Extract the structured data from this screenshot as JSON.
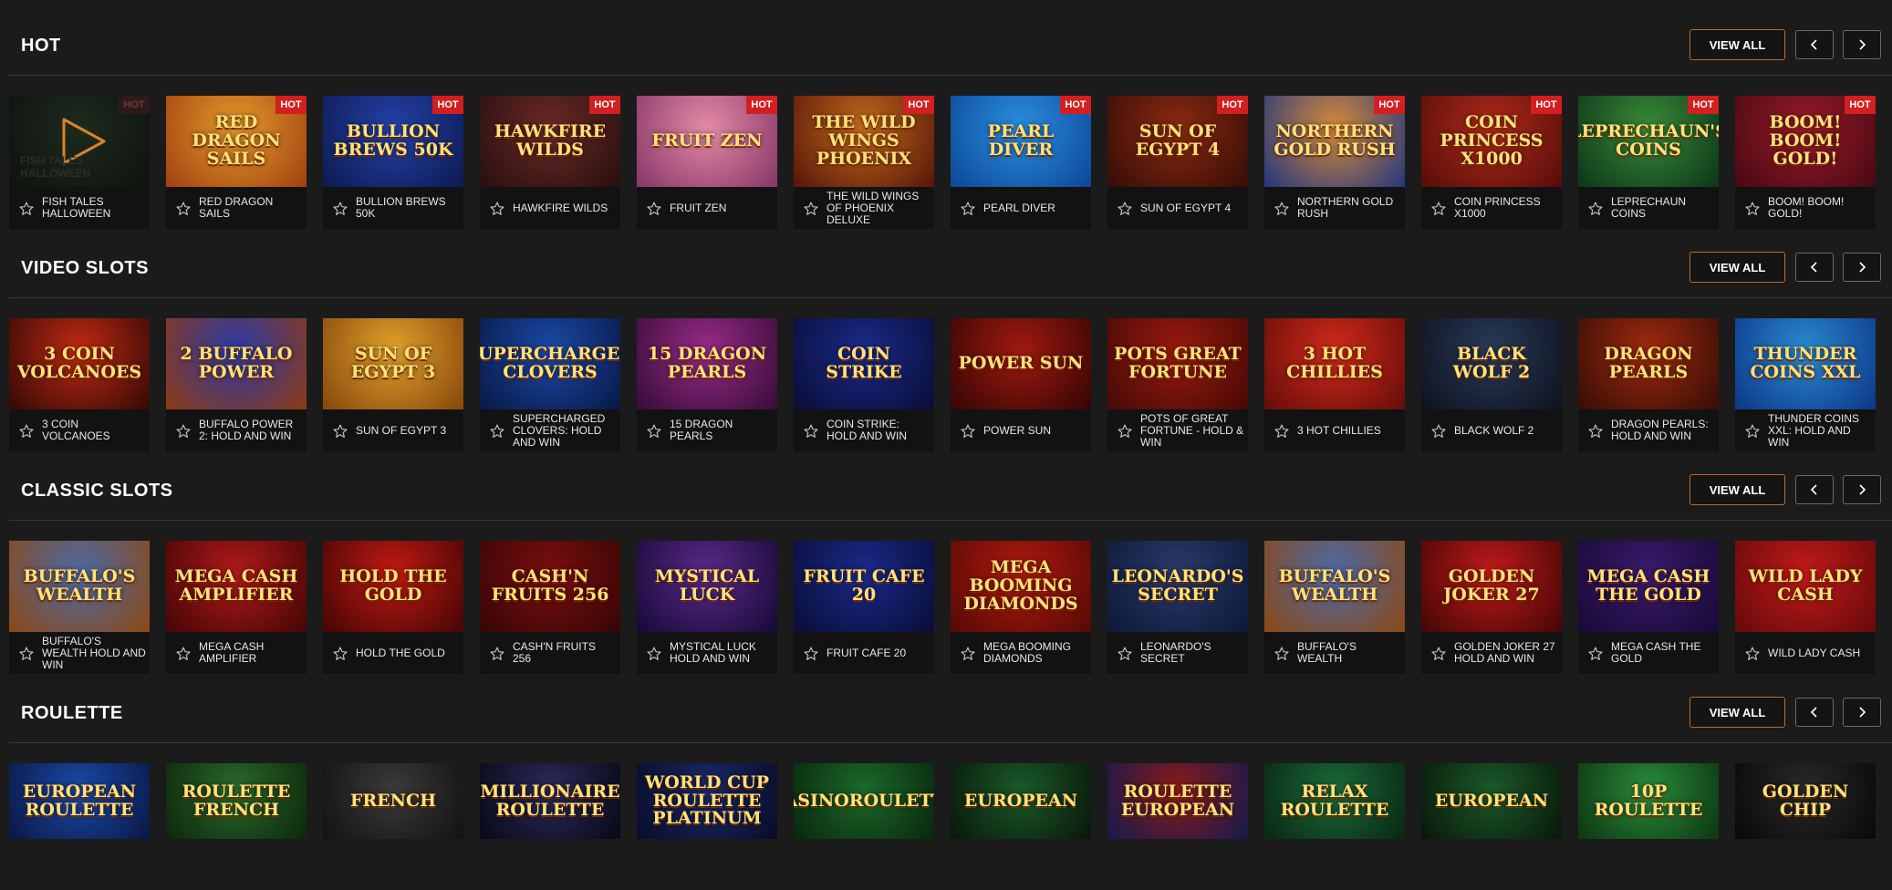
{
  "ui": {
    "view_all_label": "VIEW ALL",
    "hot_badge": "HOT"
  },
  "sections": [
    {
      "title": "HOT",
      "games": [
        {
          "name": "FISH TALES HALLOWEEN",
          "hot": true,
          "art": "FISH TALES HALLOWEEN",
          "bg": "#1e2a1e",
          "bg2": "#0e140e",
          "dimmed": true
        },
        {
          "name": "RED DRAGON SAILS",
          "hot": true,
          "art": "RED DRAGON SAILS",
          "bg": "#e39a2a",
          "bg2": "#a34512"
        },
        {
          "name": "BULLION BREWS 50K",
          "hot": true,
          "art": "BULLION BREWS 50K",
          "bg": "#2441a8",
          "bg2": "#0e1c55"
        },
        {
          "name": "HAWKFIRE WILDS",
          "hot": true,
          "art": "HAWKFIRE WILDS",
          "bg": "#6b2a26",
          "bg2": "#2a1010"
        },
        {
          "name": "FRUIT ZEN",
          "hot": true,
          "art": "FRUIT ZEN",
          "bg": "#e48aa6",
          "bg2": "#8a3a6a"
        },
        {
          "name": "THE WILD WINGS OF PHOENIX DELUXE",
          "hot": true,
          "art": "THE WILD WINGS PHOENIX",
          "bg": "#c46a1c",
          "bg2": "#5a1a0a"
        },
        {
          "name": "PEARL DIVER",
          "hot": true,
          "art": "PEARL DIVER",
          "bg": "#2a8ee0",
          "bg2": "#0e4a9a"
        },
        {
          "name": "SUN OF EGYPT 4",
          "hot": true,
          "art": "SUN OF EGYPT 4",
          "bg": "#8a2a12",
          "bg2": "#3a0e06"
        },
        {
          "name": "NORTHERN GOLD RUSH",
          "hot": true,
          "art": "NORTHERN GOLD RUSH",
          "bg": "#d88a3a",
          "bg2": "#2a3a7a"
        },
        {
          "name": "COIN PRINCESS X1000",
          "hot": true,
          "art": "COIN PRINCESS X1000",
          "bg": "#b02a1a",
          "bg2": "#5a0e0a"
        },
        {
          "name": "LEPRECHAUN COINS",
          "hot": true,
          "art": "LEPRECHAUN'S COINS",
          "bg": "#3a8a3a",
          "bg2": "#0e3a1a"
        },
        {
          "name": "BOOM! BOOM! GOLD!",
          "hot": true,
          "art": "BOOM! BOOM! GOLD!",
          "bg": "#9a1a2a",
          "bg2": "#4a0a14"
        }
      ]
    },
    {
      "title": "VIDEO SLOTS",
      "games": [
        {
          "name": "3 COIN VOLCANOES",
          "art": "3 COIN VOLCANOES",
          "bg": "#c02a12",
          "bg2": "#3a0a06"
        },
        {
          "name": "BUFFALO POWER 2: HOLD AND WIN",
          "art": "2 BUFFALO POWER",
          "bg": "#2a3aa8",
          "bg2": "#8a3a1a"
        },
        {
          "name": "SUN OF EGYPT 3",
          "art": "SUN OF EGYPT 3",
          "bg": "#e0a22a",
          "bg2": "#8a4a0e"
        },
        {
          "name": "SUPERCHARGED CLOVERS: HOLD AND WIN",
          "art": "SUPERCHARGED CLOVERS",
          "bg": "#1a4aa8",
          "bg2": "#0a1a4a"
        },
        {
          "name": "15 DRAGON PEARLS",
          "art": "15 DRAGON PEARLS",
          "bg": "#9a2a8a",
          "bg2": "#3a0e3a"
        },
        {
          "name": "COIN STRIKE: HOLD AND WIN",
          "art": "COIN STRIKE",
          "bg": "#1a2a8a",
          "bg2": "#0a0e3a"
        },
        {
          "name": "POWER SUN",
          "art": "POWER SUN",
          "bg": "#a01a0e",
          "bg2": "#3a0606"
        },
        {
          "name": "POTS OF GREAT FORTUNE - HOLD & WIN",
          "art": "POTS GREAT FORTUNE",
          "bg": "#9a1a0e",
          "bg2": "#4a0a06"
        },
        {
          "name": "3 HOT CHILLIES",
          "art": "3 HOT CHILLIES",
          "bg": "#d02a1a",
          "bg2": "#6a0e0a"
        },
        {
          "name": "BLACK WOLF 2",
          "art": "BLACK WOLF 2",
          "bg": "#2a3a5a",
          "bg2": "#0e1420"
        },
        {
          "name": "DRAGON PEARLS: HOLD AND WIN",
          "art": "DRAGON PEARLS",
          "bg": "#a02a0e",
          "bg2": "#3a0e06"
        },
        {
          "name": "THUNDER COINS XXL: HOLD AND WIN",
          "art": "THUNDER COINS XXL",
          "bg": "#2a8ad0",
          "bg2": "#0e3a8a"
        }
      ]
    },
    {
      "title": "CLASSIC SLOTS",
      "games": [
        {
          "name": "BUFFALO'S WEALTH HOLD AND WIN",
          "art": "BUFFALO'S WEALTH",
          "bg": "#4a6aa8",
          "bg2": "#8a4a1a"
        },
        {
          "name": "MEGA CASH AMPLIFIER",
          "art": "MEGA CASH AMPLIFIER",
          "bg": "#b01a1a",
          "bg2": "#4a0606"
        },
        {
          "name": "HOLD THE GOLD",
          "art": "HOLD THE GOLD",
          "bg": "#c01a12",
          "bg2": "#4a0606"
        },
        {
          "name": "CASH'N FRUITS 256",
          "art": "CASH'N FRUITS 256",
          "bg": "#7a0e0e",
          "bg2": "#3a0606"
        },
        {
          "name": "MYSTICAL LUCK HOLD AND WIN",
          "art": "MYSTICAL LUCK",
          "bg": "#5a2a8a",
          "bg2": "#1a0a3a"
        },
        {
          "name": "FRUIT CAFE 20",
          "art": "FRUIT CAFE 20",
          "bg": "#1a2a8a",
          "bg2": "#0a0e3a"
        },
        {
          "name": "MEGA BOOMING DIAMONDS",
          "art": "MEGA BOOMING DIAMONDS",
          "bg": "#b01a0e",
          "bg2": "#5a0a06"
        },
        {
          "name": "LEONARDO'S SECRET",
          "art": "LEONARDO'S SECRET",
          "bg": "#2a3a6a",
          "bg2": "#0e1a3a"
        },
        {
          "name": "BUFFALO'S WEALTH",
          "art": "BUFFALO'S WEALTH",
          "bg": "#4a6aa8",
          "bg2": "#8a4a1a"
        },
        {
          "name": "GOLDEN JOKER 27 HOLD AND WIN",
          "art": "GOLDEN JOKER 27",
          "bg": "#c01a1a",
          "bg2": "#4a0606"
        },
        {
          "name": "MEGA CASH THE GOLD",
          "art": "MEGA CASH THE GOLD",
          "bg": "#3a1a6a",
          "bg2": "#1a0a3a"
        },
        {
          "name": "WILD LADY CASH",
          "art": "Wild Lady Cash",
          "bg": "#c01a1a",
          "bg2": "#6a0a0a"
        }
      ]
    },
    {
      "title": "ROULETTE",
      "games": [
        {
          "name": "",
          "art": "European Roulette",
          "bg": "#1a4aa8",
          "bg2": "#0a1a4a"
        },
        {
          "name": "",
          "art": "Roulette FRENCH",
          "bg": "#2a6a2a",
          "bg2": "#0e2a0e"
        },
        {
          "name": "",
          "art": "French",
          "bg": "#3a3a3a",
          "bg2": "#141414"
        },
        {
          "name": "",
          "art": "MILLIONAIRE ROULETTE",
          "bg": "#2a2a5a",
          "bg2": "#0a0a1a"
        },
        {
          "name": "",
          "art": "WORLD CUP ROULETTE PLATINUM",
          "bg": "#1a2a6a",
          "bg2": "#0a0e2a"
        },
        {
          "name": "",
          "art": "CasinoRoulette",
          "bg": "#1a6a2a",
          "bg2": "#0a2a0e"
        },
        {
          "name": "",
          "art": "EUROPEAN",
          "bg": "#1a5a2a",
          "bg2": "#0a1a0a"
        },
        {
          "name": "",
          "art": "ROULETTE EUROPEAN",
          "bg": "#8a1a1a",
          "bg2": "#1a1a4a"
        },
        {
          "name": "",
          "art": "RELAX ROULETTE",
          "bg": "#1a6a3a",
          "bg2": "#0a2a14"
        },
        {
          "name": "",
          "art": "EUROPEAN",
          "bg": "#1a5a2a",
          "bg2": "#0a1a0a"
        },
        {
          "name": "",
          "art": "10p Roulette",
          "bg": "#2a8a3a",
          "bg2": "#0e3a14"
        },
        {
          "name": "",
          "art": "GOLDEN CHIP",
          "bg": "#2a2a2a",
          "bg2": "#0a0a0a"
        }
      ]
    }
  ]
}
